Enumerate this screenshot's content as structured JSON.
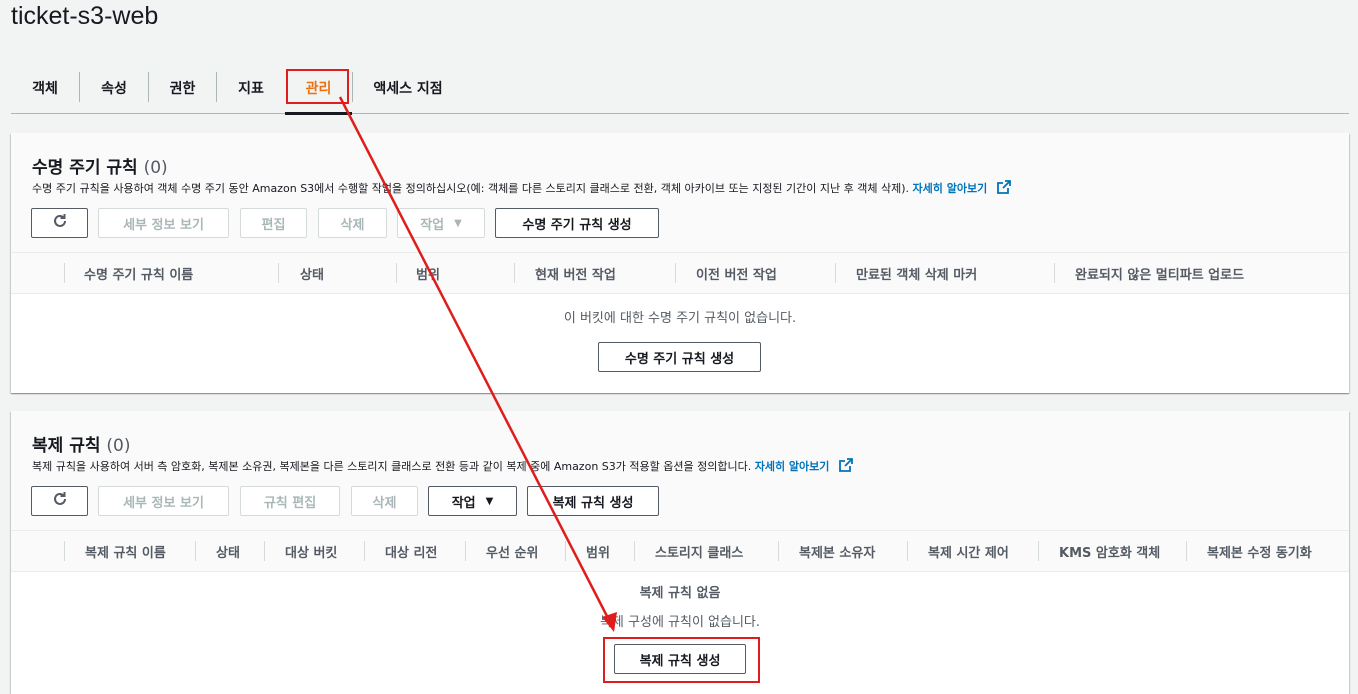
{
  "page": {
    "title": "ticket-s3-web"
  },
  "tabs": [
    {
      "label": "객체"
    },
    {
      "label": "속성"
    },
    {
      "label": "권한"
    },
    {
      "label": "지표"
    },
    {
      "label": "관리",
      "active": true
    },
    {
      "label": "액세스 지점"
    }
  ],
  "lifecycle": {
    "title": "수명 주기 규칙",
    "count": "(0)",
    "description": "수명 주기 규칙을 사용하여 객체 수명 주기 동안 Amazon S3에서 수행할 작업을 정의하십시오(예: 객체를 다른 스토리지 클래스로 전환, 객체 아카이브 또는 지정된 기간이 지난 후 객체 삭제).",
    "learn_more": "자세히 알아보기",
    "buttons": {
      "details": "세부 정보 보기",
      "edit": "편집",
      "delete": "삭제",
      "actions": "작업",
      "create": "수명 주기 규칙 생성"
    },
    "columns": [
      "수명 주기 규칙 이름",
      "상태",
      "범위",
      "현재 버전 작업",
      "이전 버전 작업",
      "만료된 객체 삭제 마커",
      "완료되지 않은 멀티파트 업로드"
    ],
    "empty_message": "이 버킷에 대한 수명 주기 규칙이 없습니다.",
    "empty_create": "수명 주기 규칙 생성"
  },
  "replication": {
    "title": "복제 규칙",
    "count": "(0)",
    "description": "복제 규칙을 사용하여 서버 측 암호화, 복제본 소유권, 복제본을 다른 스토리지 클래스로 전환 등과 같이 복제 중에 Amazon S3가 적용할 옵션을 정의합니다.",
    "learn_more": "자세히 알아보기",
    "buttons": {
      "details": "세부 정보 보기",
      "edit": "규칙 편집",
      "delete": "삭제",
      "actions": "작업",
      "create": "복제 규칙 생성"
    },
    "columns": [
      "복제 규칙 이름",
      "상태",
      "대상 버킷",
      "대상 리전",
      "우선 순위",
      "범위",
      "스토리지 클래스",
      "복제본 소유자",
      "복제 시간 제어",
      "KMS 암호화 객체",
      "복제본 수정 동기화"
    ],
    "empty_title": "복제 규칙 없음",
    "empty_message": "복제 구성에 규칙이 없습니다.",
    "empty_create": "복제 규칙 생성"
  },
  "icons": {
    "refresh": "refresh-icon",
    "external": "external-link-icon",
    "caret": "caret-down-icon"
  },
  "colors": {
    "highlight": "#e01d1d",
    "active_tab": "#ec7211",
    "link": "#0073bb"
  }
}
